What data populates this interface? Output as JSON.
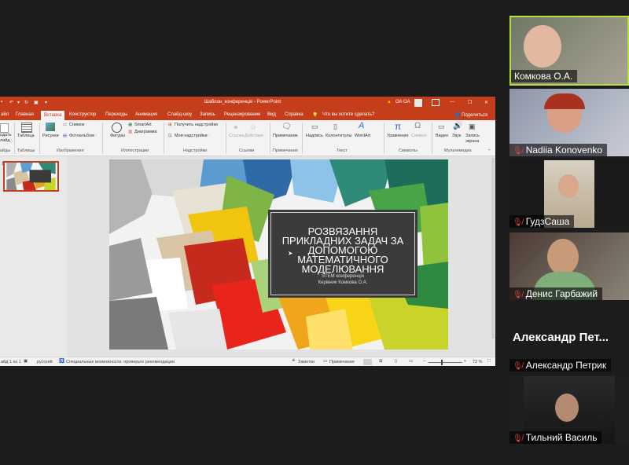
{
  "ppt": {
    "title": "Шаблон_конференція  -  PowerPoint",
    "user": "OA OA",
    "share": "Поделиться",
    "tell_me": "Что вы хотите сделать?",
    "tabs": [
      "айл",
      "Главная",
      "Вставка",
      "Конструктор",
      "Переходы",
      "Анимация",
      "Слайд-шоу",
      "Запись",
      "Рецензирование",
      "Вид",
      "Справка"
    ],
    "active_tab": "Вставка",
    "ribbon": {
      "slides_a": "одать",
      "slides_b": "лайд ·",
      "slides_group": "айды",
      "table": "Таблица",
      "tables_group": "Таблицы",
      "pictures": "Рисунки",
      "snapshot": "Снимок ·",
      "photoalbum": "Фотоальбом ·",
      "images_group": "Изображения",
      "shapes": "Фигуры",
      "smartart": "SmartArt",
      "chart": "Диаграмма",
      "illustrations_group": "Иллюстрации",
      "get_addins": "Получить надстройки",
      "my_addins": "Мои надстройки ·",
      "addins_group": "Надстройки",
      "link": "Ссылка",
      "action": "Действие",
      "links_group": "Ссылки",
      "comment": "Примечание",
      "comments_group": "Примечания",
      "textbox": "Надпись",
      "headerfooter": "Колонтитулы",
      "wordart": "WordArt",
      "text_group": "Текст",
      "equation": "Уравнение",
      "symbol": "Символ",
      "symbols_group": "Символы",
      "video": "Видео",
      "audio": "Звук",
      "screenrec_a": "Запись",
      "screenrec_b": "экрана",
      "media_group": "Мультимедиа"
    },
    "slide": {
      "title": "Розвязання прикладних задач за допомогою математичного моделювання",
      "subtitle1": "STEM конференція",
      "subtitle2": "Керівник Комкова О.А."
    },
    "status": {
      "slide_count": "айд 1 из 1",
      "language": "русский",
      "accessibility": "Специальные возможности: проверьте рекомендации",
      "notes": "Заметки",
      "comments": "Примечания",
      "zoom": "72 %"
    }
  },
  "participants": [
    {
      "name": "Комкова О.А.",
      "muted": false
    },
    {
      "name": "Nadiia Konovenko",
      "muted": true
    },
    {
      "name": "ГудзСаша",
      "muted": true
    },
    {
      "name": "Денис Гарбажий",
      "muted": true
    },
    {
      "name": "Александр Петрик",
      "muted": true,
      "display": "Александр  Пет..."
    },
    {
      "name": "Тильний Василь",
      "muted": true
    }
  ]
}
